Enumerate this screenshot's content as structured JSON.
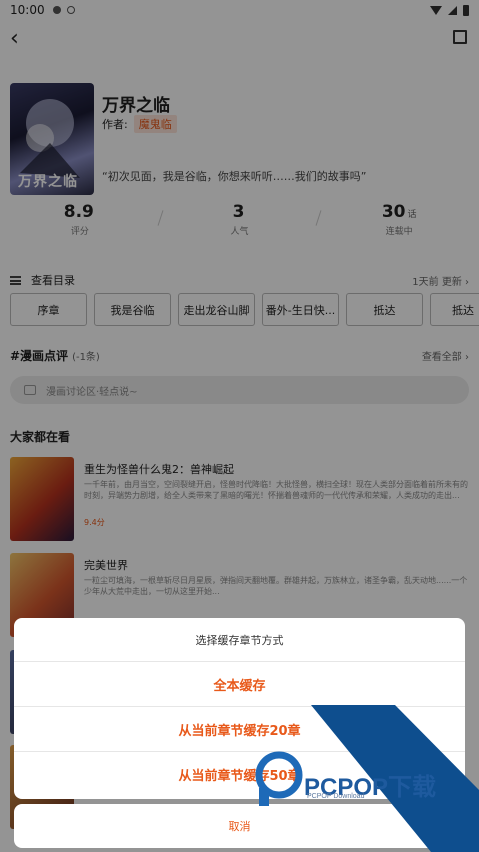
{
  "status": {
    "time": "10:00"
  },
  "book": {
    "title": "万界之临",
    "author_label": "作者:",
    "author": "魔鬼临",
    "cover_text": "万界之临",
    "quote": "“初次见面，我是谷临，你想来听听……我们的故事吗”"
  },
  "stats": [
    {
      "value": "8.9",
      "unit": "",
      "label": "评分"
    },
    {
      "value": "3",
      "unit": "",
      "label": "人气"
    },
    {
      "value": "30",
      "unit": "话",
      "label": "连载中"
    }
  ],
  "toc": {
    "label": "查看目录",
    "update": "1天前 更新 ›"
  },
  "chapters": [
    "序章",
    "我是谷临",
    "走出龙谷山脚",
    "番外-生日快...",
    "抵达",
    "抵达（"
  ],
  "reviews": {
    "title": "#漫画点评",
    "count": "(-1条)",
    "see_all": "查看全部 ›",
    "placeholder": "漫画讨论区·轻点说~"
  },
  "section_title": "大家都在看",
  "recommend": [
    {
      "title": "重生为怪兽什么鬼2：兽神崛起",
      "desc": "一千年前，由月当空，空间裂缝开启，怪兽时代降临！大批怪兽，横扫全球！现在人类部分面临着前所未有的时刻，异端势力剧增，给全人类带来了黑暗的曙光！怀揣着兽魂师的一代代传承和荣耀，人类成功的走出...",
      "rating": "9.4分"
    },
    {
      "title": "完美世界",
      "desc": "一粒尘可填海，一根草斩尽日月星辰，弹指间天翻地覆。群雄并起，万族林立，诸圣争霸，乱天动地......一个少年从大荒中走出，一切从这里开始...",
      "rating": ""
    }
  ],
  "dialog": {
    "title": "选择缓存章节方式",
    "options": [
      "全本缓存",
      "从当前章节缓存20章",
      "从当前章节缓存50章"
    ],
    "cancel": "取消"
  },
  "watermark": {
    "text": "PCPOP下载",
    "sub": "PCPOP Download"
  },
  "colors": {
    "accent": "#e8591a",
    "watermark_blue": "#0e4e8e"
  }
}
